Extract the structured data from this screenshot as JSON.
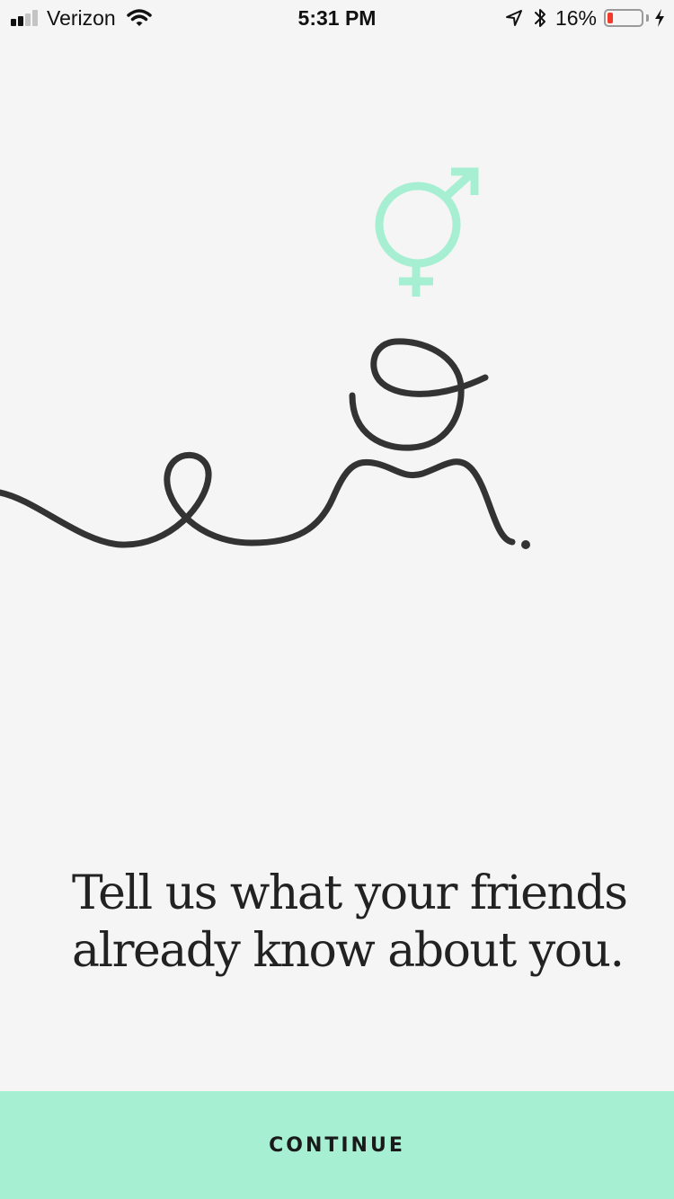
{
  "status_bar": {
    "carrier": "Verizon",
    "time": "5:31 PM",
    "battery_percent": "16%",
    "battery_level": 0.16,
    "icons": [
      "signal-icon",
      "wifi-icon",
      "location-arrow-icon",
      "bluetooth-icon",
      "battery-icon",
      "charging-bolt-icon"
    ]
  },
  "illustration": {
    "icons": [
      "gender-symbol-icon",
      "squiggle-line-icon"
    ],
    "colors": {
      "accent": "#a6efd3",
      "line": "#333333"
    }
  },
  "headline": "Tell us what your friends already know about you.",
  "continue_label": "CONTINUE",
  "colors": {
    "background": "#f5f5f5",
    "button": "#a6efd3",
    "text": "#222222"
  }
}
